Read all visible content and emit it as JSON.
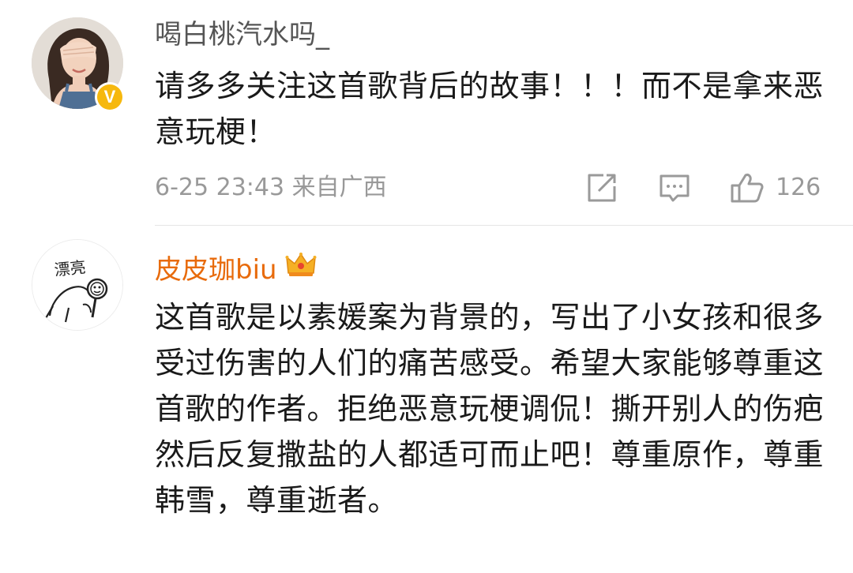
{
  "comments": [
    {
      "username": "喝白桃汽水吗_",
      "verified_badge": "V",
      "text": "请多多关注这首歌背后的故事！！！而不是拿来恶意玩梗！",
      "meta": "6-25 23:43 来自广西",
      "likes": "126",
      "icons": [
        "share-icon",
        "reply-icon",
        "like-icon"
      ]
    },
    {
      "username": "皮皮珈biu",
      "avatar_text": "漂亮",
      "text": "这首歌是以素媛案为背景的，写出了小女孩和很多受过伤害的人们的痛苦感受。希望大家能够尊重这首歌的作者。拒绝恶意玩梗调侃！撕开别人的伤疤然后反复撒盐的人都适可而止吧！尊重原作，尊重韩雪，尊重逝者。",
      "icons": [
        "crown-icon"
      ]
    }
  ],
  "colors": {
    "username_gray": "#555555",
    "username_vip": "#e86b0c",
    "meta_gray": "#999999",
    "badge_yellow": "#f6b80e"
  }
}
